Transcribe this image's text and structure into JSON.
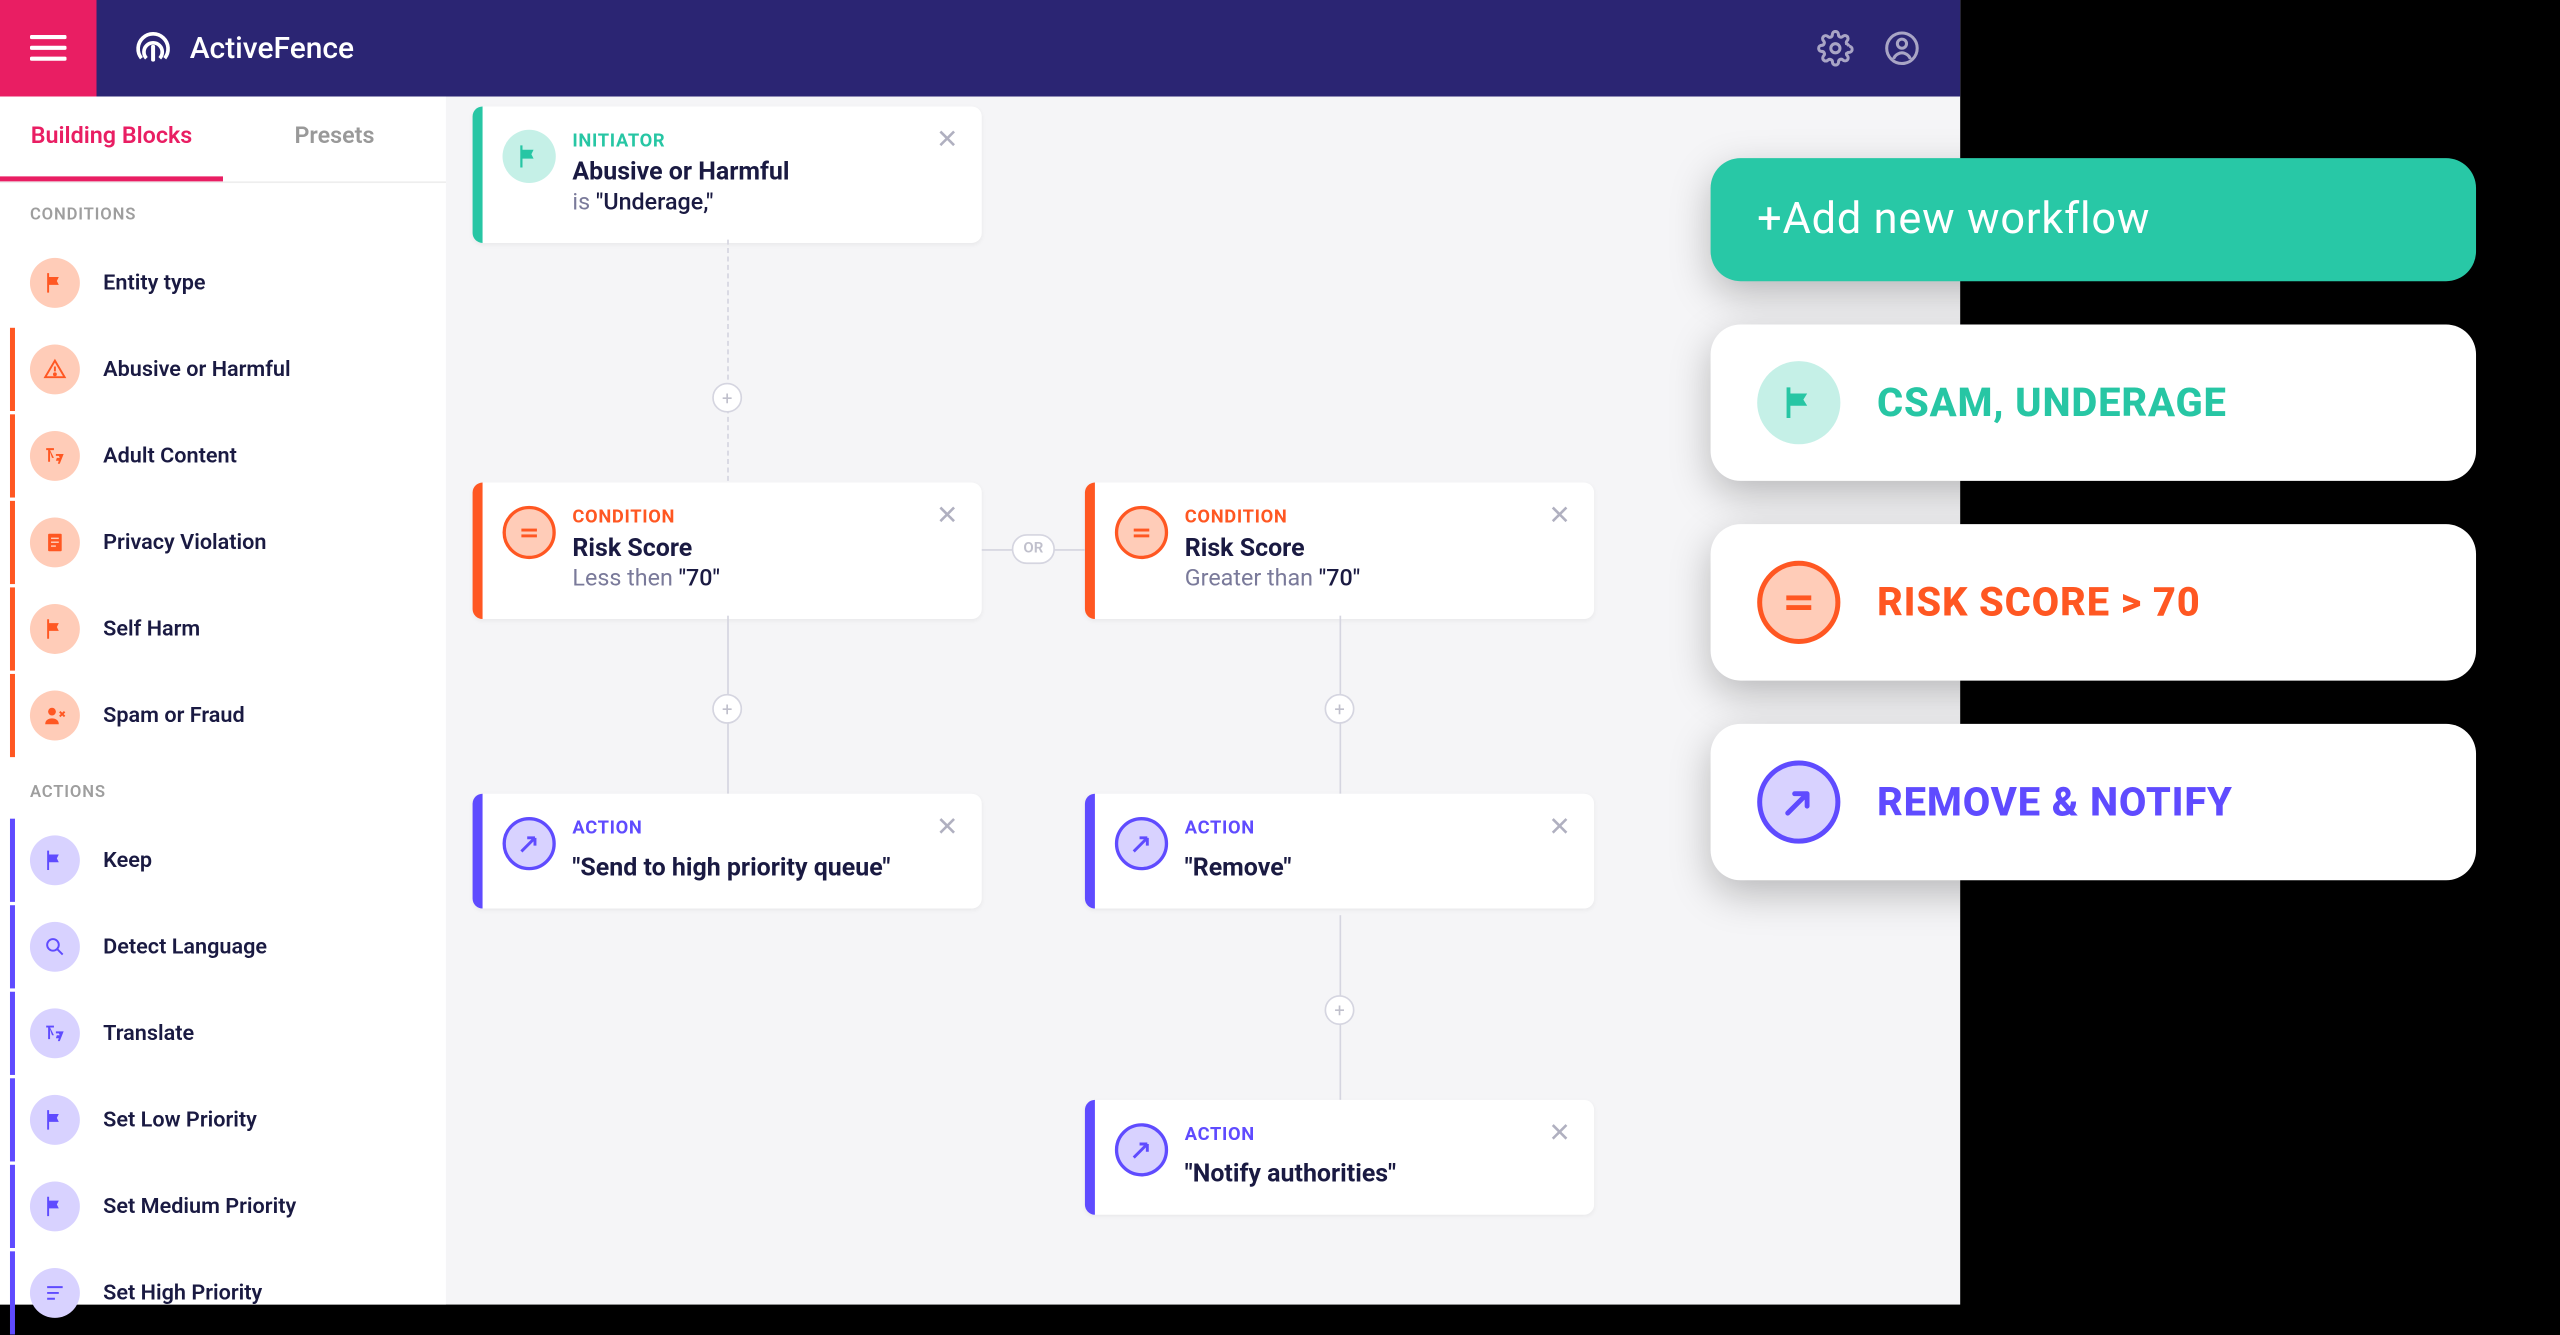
{
  "brand": "ActiveFence",
  "tabs": {
    "building_blocks": "Building Blocks",
    "presets": "Presets"
  },
  "sidebar": {
    "conditions_label": "CONDITIONS",
    "actions_label": "ACTIONS",
    "conditions": [
      {
        "label": "Entity type",
        "icon": "flag"
      },
      {
        "label": "Abusive or Harmful",
        "icon": "warning"
      },
      {
        "label": "Adult Content",
        "icon": "translate"
      },
      {
        "label": "Privacy Violation",
        "icon": "document"
      },
      {
        "label": "Self Harm",
        "icon": "flag"
      },
      {
        "label": "Spam or Fraud",
        "icon": "user-x"
      }
    ],
    "actions": [
      {
        "label": "Keep",
        "icon": "flag"
      },
      {
        "label": "Detect Language",
        "icon": "search"
      },
      {
        "label": "Translate",
        "icon": "translate"
      },
      {
        "label": "Set Low Priority",
        "icon": "flag"
      },
      {
        "label": "Set Medium Priority",
        "icon": "flag"
      },
      {
        "label": "Set High Priority",
        "icon": "priority"
      }
    ]
  },
  "cards": {
    "initiator": {
      "kicker": "INITIATOR",
      "title": "Abusive or Harmful",
      "sub_prefix": "is  ",
      "sub_value": "\"Underage,\""
    },
    "cond_left": {
      "kicker": "CONDITION",
      "title": "Risk Score",
      "sub_prefix": "Less then ",
      "sub_value": "\"70\""
    },
    "cond_right": {
      "kicker": "CONDITION",
      "title": "Risk Score",
      "sub_prefix": "Greater than ",
      "sub_value": "\"70\""
    },
    "act_left": {
      "kicker": "ACTION",
      "value": "\"Send to high priority queue\""
    },
    "act_right": {
      "kicker": "ACTION",
      "value": "\"Remove\""
    },
    "act_notify": {
      "kicker": "ACTION",
      "value": "\"Notify authorities\""
    }
  },
  "connectors": {
    "or": "OR"
  },
  "floaters": {
    "add": "+Add new workflow",
    "csam": "CSAM, UNDERAGE",
    "risk": "RISK SCORE > 70",
    "remove": "REMOVE & NOTIFY"
  }
}
